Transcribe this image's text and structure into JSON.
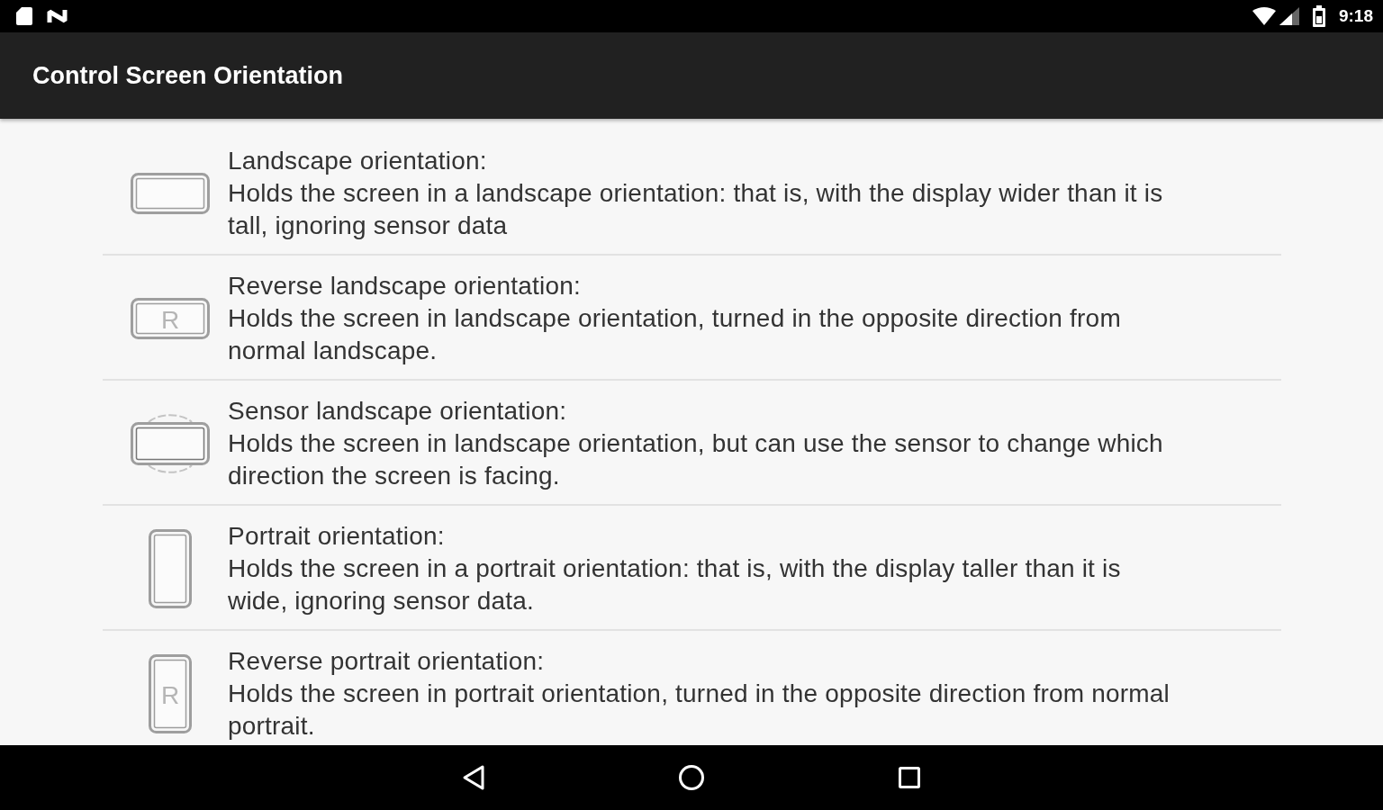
{
  "status_bar": {
    "time": "9:18"
  },
  "app_bar": {
    "title": "Control Screen Orientation"
  },
  "options": [
    {
      "kind": "landscape",
      "title": "Landscape orientation:",
      "description": "Holds the screen in a landscape orientation: that is, with the display wider than it is tall, ignoring sensor data"
    },
    {
      "kind": "landscape",
      "icon_letter": "R",
      "title": "Reverse landscape orientation:",
      "description": "Holds the screen in landscape orientation, turned in the opposite direction from normal landscape."
    },
    {
      "kind": "sensor_landscape",
      "title": "Sensor landscape orientation:",
      "description": "Holds the screen in landscape orientation, but can use the sensor to change which direction the screen is facing."
    },
    {
      "kind": "portrait",
      "title": "Portrait orientation:",
      "description": "Holds the screen in a portrait orientation: that is, with the display taller than it is wide, ignoring sensor data."
    },
    {
      "kind": "portrait",
      "icon_letter": "R",
      "title": "Reverse portrait orientation:",
      "description": "Holds the screen in portrait orientation, turned in the opposite direction from normal portrait."
    }
  ]
}
